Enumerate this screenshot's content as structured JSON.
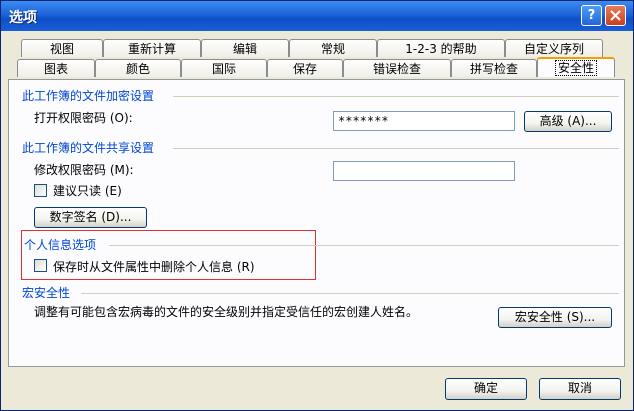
{
  "window": {
    "title": "选项",
    "help_glyph": "?",
    "close_icon": "close-icon"
  },
  "tabs_back": [
    "视图",
    "重新计算",
    "编辑",
    "常规",
    "1-2-3 的帮助",
    "自定义序列"
  ],
  "tabs_front": [
    "图表",
    "颜色",
    "国际",
    "保存",
    "错误检查",
    "拼写检查",
    "安全性"
  ],
  "active_tab": "安全性",
  "encrypt": {
    "title": "此工作簿的文件加密设置",
    "open_password_label": "打开权限密码 (O):",
    "open_password_value": "*******",
    "advanced_button": "高级 (A)..."
  },
  "share": {
    "title": "此工作簿的文件共享设置",
    "modify_password_label": "修改权限密码 (M):",
    "modify_password_value": "",
    "read_only_label": "建议只读 (E)",
    "digital_sign_button": "数字签名 (D)..."
  },
  "privacy": {
    "title": "个人信息选项",
    "remove_info_label": "保存时从文件属性中删除个人信息 (R)"
  },
  "macro": {
    "title": "宏安全性",
    "description": "调整有可能包含宏病毒的文件的安全级别并指定受信任的宏创建人姓名。",
    "button": "宏安全性 (S)..."
  },
  "footer": {
    "ok": "确定",
    "cancel": "取消"
  },
  "colors": {
    "group_title": "#0046d5",
    "titlebar": "#0d4fc7",
    "highlight": "#e03030"
  }
}
